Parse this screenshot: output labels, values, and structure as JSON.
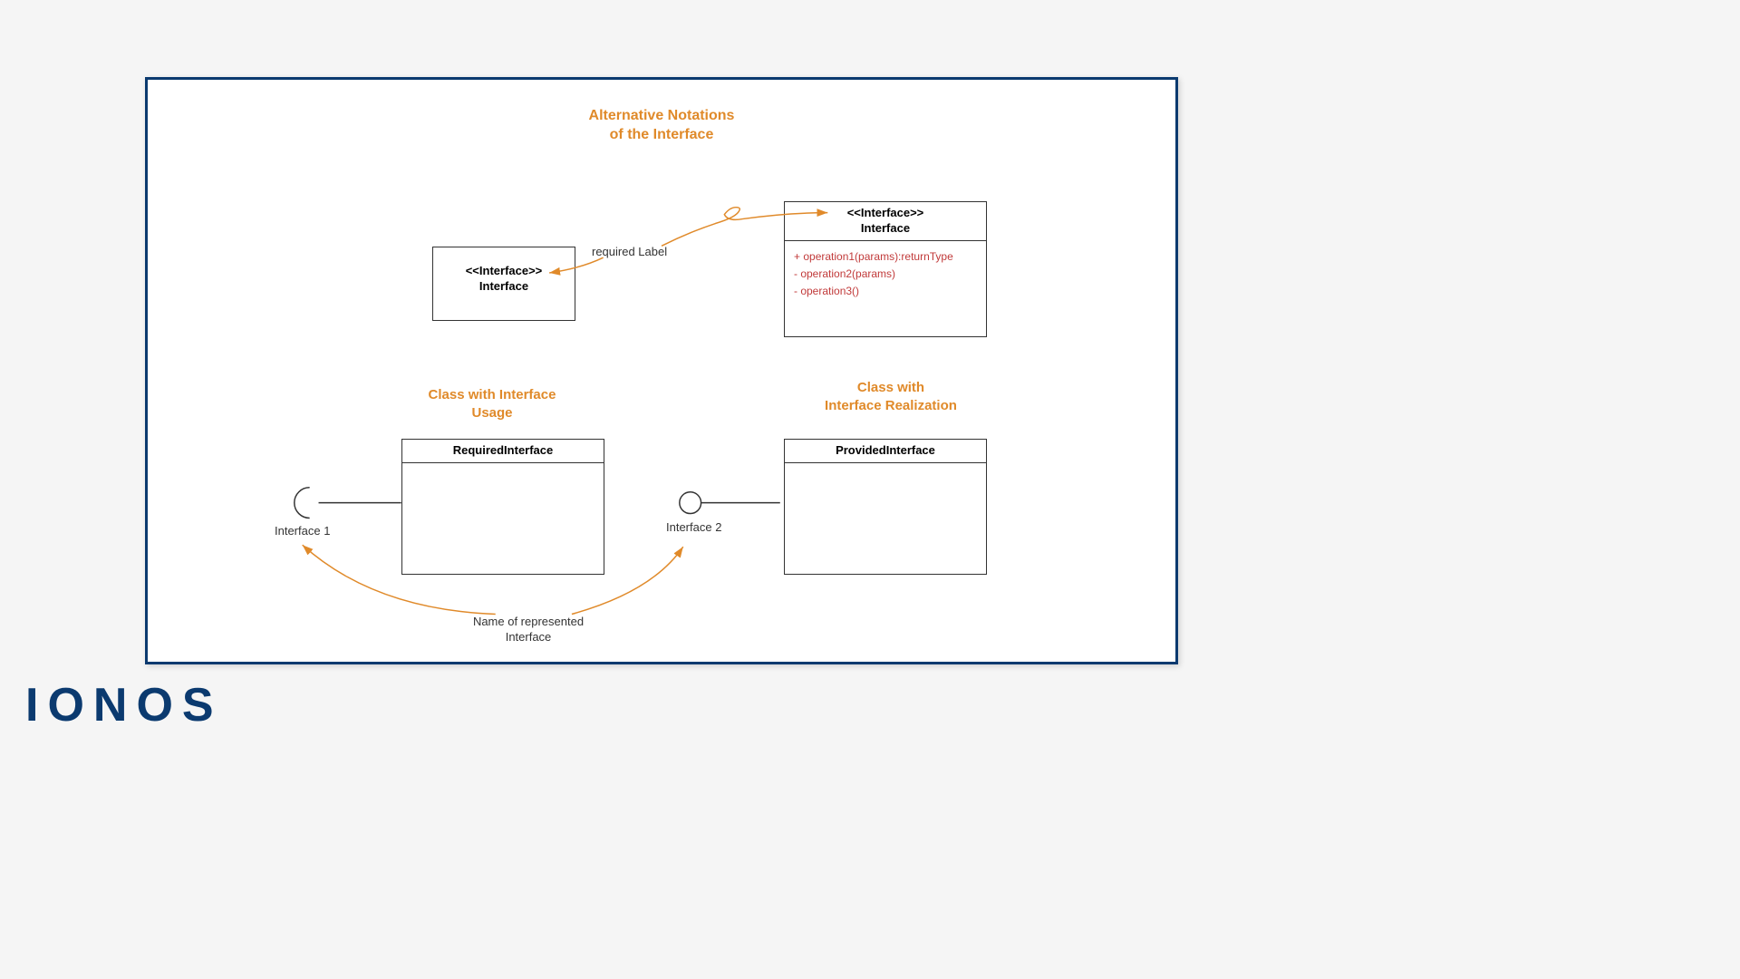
{
  "titles": {
    "main_l1": "Alternative Notations",
    "main_l2": "of the Interface",
    "usage_l1": "Class with Interface",
    "usage_l2": "Usage",
    "realization_l1": "Class with",
    "realization_l2": "Interface Realization"
  },
  "boxes": {
    "small_interface": {
      "stereotype": "<<Interface>>",
      "name": "Interface"
    },
    "large_interface": {
      "stereotype": "<<Interface>>",
      "name": "Interface",
      "op1": "+ operation1(params):returnType",
      "op2": "- operation2(params)",
      "op3": "- operation3()"
    },
    "required": {
      "name": "RequiredInterface"
    },
    "provided": {
      "name": "ProvidedInterface"
    }
  },
  "labels": {
    "required_label": "required Label",
    "interface1": "Interface 1",
    "interface2": "Interface 2",
    "name_of_l1": "Name of represented",
    "name_of_l2": "Interface"
  },
  "logo": "IONOS"
}
